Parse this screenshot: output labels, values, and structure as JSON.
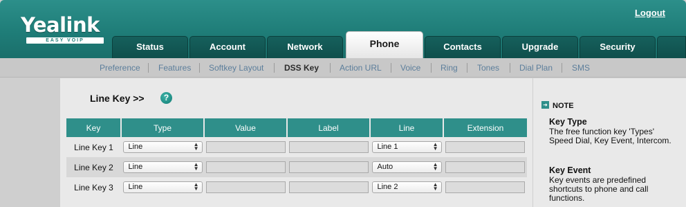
{
  "header": {
    "logo": "Yealink",
    "logo_sub": "EASY VOIP",
    "logout": "Logout",
    "tabs": [
      {
        "label": "Status"
      },
      {
        "label": "Account"
      },
      {
        "label": "Network"
      },
      {
        "label": "Phone",
        "active": true
      },
      {
        "label": "Contacts"
      },
      {
        "label": "Upgrade"
      },
      {
        "label": "Security"
      }
    ]
  },
  "subnav": {
    "items": [
      "Preference",
      "Features",
      "Softkey Layout",
      "DSS Key",
      "Action URL",
      "Voice",
      "Ring",
      "Tones",
      "Dial Plan",
      "SMS"
    ],
    "active": "DSS Key"
  },
  "main": {
    "section_title": "Line Key >>",
    "help_icon": "question-mark",
    "table": {
      "headers": [
        "Key",
        "Type",
        "Value",
        "Label",
        "Line",
        "Extension"
      ],
      "rows": [
        {
          "key": "Line Key 1",
          "type": "Line",
          "value": "",
          "label": "",
          "line": "Line 1",
          "extension": ""
        },
        {
          "key": "Line Key 2",
          "type": "Line",
          "value": "",
          "label": "",
          "line": "Auto",
          "extension": ""
        },
        {
          "key": "Line Key 3",
          "type": "Line",
          "value": "",
          "label": "",
          "line": "Line 2",
          "extension": ""
        }
      ]
    }
  },
  "note": {
    "heading": "NOTE",
    "blocks": [
      {
        "title": "Key Type",
        "text": "The free function key 'Types' Speed Dial, Key Event, Intercom."
      },
      {
        "title": "Key Event",
        "text": "Key events are predefined shortcuts to phone and call functions."
      }
    ]
  },
  "colors": {
    "brand_teal": "#1f7d78",
    "table_header": "#2f8f8a",
    "subnav_link": "#5c7e9b"
  }
}
